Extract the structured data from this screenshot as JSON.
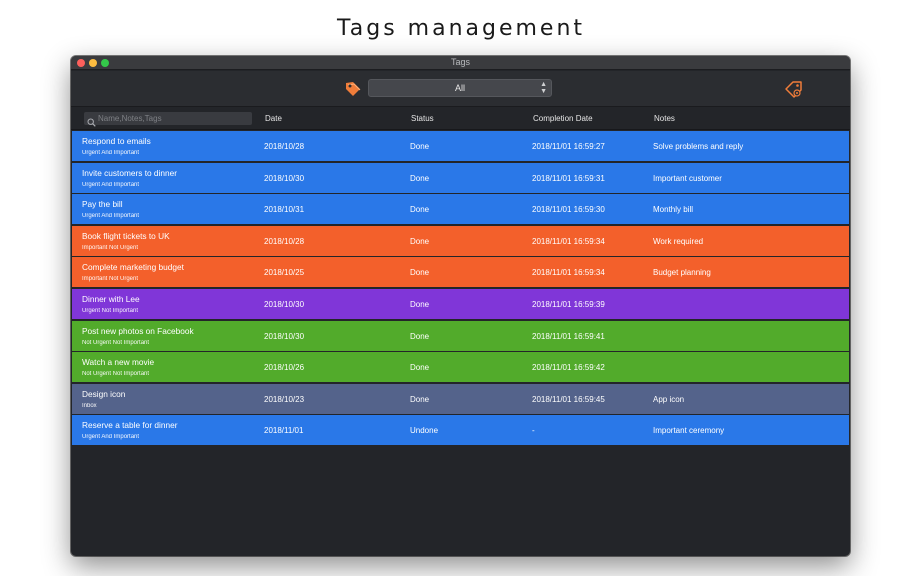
{
  "page": {
    "title": "Tags management"
  },
  "window": {
    "title": "Tags"
  },
  "toolbar": {
    "filter_value": "All",
    "tag_icon": "price-tag-icon",
    "manage_icon": "tag-settings-icon",
    "tag_icon_color": "#f07d3a"
  },
  "search": {
    "placeholder": "Name,Notes,Tags",
    "value": ""
  },
  "columns": {
    "date": "Date",
    "status": "Status",
    "completion": "Completion Date",
    "notes": "Notes"
  },
  "colors": {
    "urgent_important": "#2a78e8",
    "important_not_urgent": "#f3602b",
    "urgent_not_important": "#8036d8",
    "not_urgent_not_important": "#52ab2b",
    "inbox": "#54638b"
  },
  "rows": [
    {
      "title": "Respond to emails",
      "tag": "Urgent And Important",
      "date": "2018/10/28",
      "status": "Done",
      "completion": "2018/11/01 16:59:27",
      "notes": "Solve problems and reply",
      "color": "#2a78e8"
    },
    {
      "title": "Invite customers to dinner",
      "tag": "Urgent And Important",
      "date": "2018/10/30",
      "status": "Done",
      "completion": "2018/11/01 16:59:31",
      "notes": "Important customer",
      "color": "#2a78e8"
    },
    {
      "title": "Pay the bill",
      "tag": "Urgent And Important",
      "date": "2018/10/31",
      "status": "Done",
      "completion": "2018/11/01 16:59:30",
      "notes": "Monthly bill",
      "color": "#2a78e8"
    },
    {
      "title": "Book flight tickets to UK",
      "tag": "Important Not Urgent",
      "date": "2018/10/28",
      "status": "Done",
      "completion": "2018/11/01 16:59:34",
      "notes": "Work required",
      "color": "#f3602b"
    },
    {
      "title": "Complete marketing budget",
      "tag": "Important Not Urgent",
      "date": "2018/10/25",
      "status": "Done",
      "completion": "2018/11/01 16:59:34",
      "notes": "Budget planning",
      "color": "#f3602b"
    },
    {
      "title": "Dinner with Lee",
      "tag": "Urgent Not Important",
      "date": "2018/10/30",
      "status": "Done",
      "completion": "2018/11/01 16:59:39",
      "notes": "",
      "color": "#8036d8"
    },
    {
      "title": "Post new photos on Facebook",
      "tag": "Not Urgent Not Important",
      "date": "2018/10/30",
      "status": "Done",
      "completion": "2018/11/01 16:59:41",
      "notes": "",
      "color": "#52ab2b"
    },
    {
      "title": "Watch a new movie",
      "tag": "Not Urgent Not Important",
      "date": "2018/10/26",
      "status": "Done",
      "completion": "2018/11/01 16:59:42",
      "notes": "",
      "color": "#52ab2b"
    },
    {
      "title": "Design icon",
      "tag": "Inbox",
      "date": "2018/10/23",
      "status": "Done",
      "completion": "2018/11/01 16:59:45",
      "notes": "App icon",
      "color": "#54638b"
    },
    {
      "title": "Reserve a table for dinner",
      "tag": "Urgent And Important",
      "date": "2018/11/01",
      "status": "Undone",
      "completion": "-",
      "notes": "Important ceremony",
      "color": "#2a78e8"
    }
  ]
}
